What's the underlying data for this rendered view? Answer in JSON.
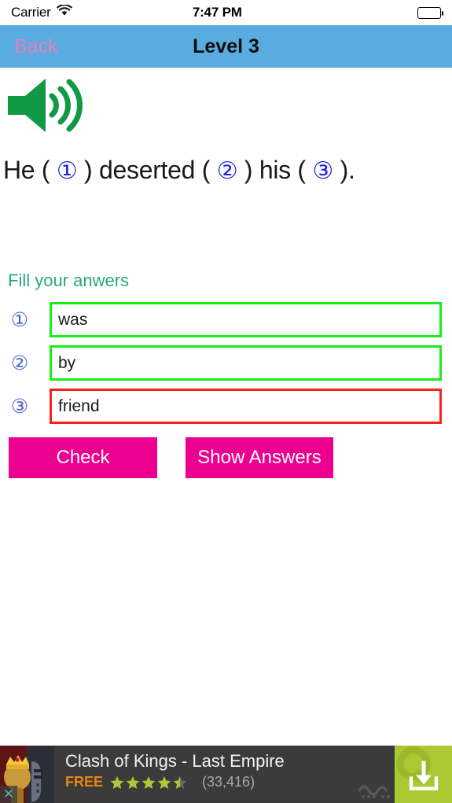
{
  "status_bar": {
    "carrier": "Carrier",
    "time": "7:47 PM",
    "wifi_icon": "wifi-icon",
    "battery_icon": "battery-full-icon"
  },
  "nav_bar": {
    "back_label": "Back",
    "title": "Level 3",
    "background_color": "#59acdf",
    "back_color": "#e87ec0"
  },
  "question": {
    "speaker_icon": "speaker-sound-icon",
    "speaker_color": "#119944",
    "sentence_parts": {
      "p1": "He ( ",
      "n1": "①",
      "p2": " ) deserted ( ",
      "n2": "②",
      "p3": " ) his ( ",
      "n3": "③",
      "p4": " )."
    },
    "blank_number_color": "#2222dd"
  },
  "answers_section": {
    "label": "Fill your anwers",
    "label_color": "#2aa882",
    "rows": [
      {
        "marker": "①",
        "value": "was",
        "state": "correct",
        "border_color": "#16ee16"
      },
      {
        "marker": "②",
        "value": "by",
        "state": "correct",
        "border_color": "#16ee16"
      },
      {
        "marker": "③",
        "value": "friend",
        "state": "wrong",
        "border_color": "#f92020"
      }
    ]
  },
  "buttons": {
    "check_label": "Check",
    "show_answers_label": "Show Answers",
    "color": "#ec0090"
  },
  "ad_banner": {
    "icon_name": "clash-of-kings-app-icon",
    "close_label": "✕",
    "title": "Clash of Kings - Last Empire",
    "price": "FREE",
    "rating": 4.5,
    "rating_count": "(33,416)",
    "cta_icon": "download-icon",
    "cta_color": "#aac832",
    "background_color": "#3b3b3b"
  }
}
